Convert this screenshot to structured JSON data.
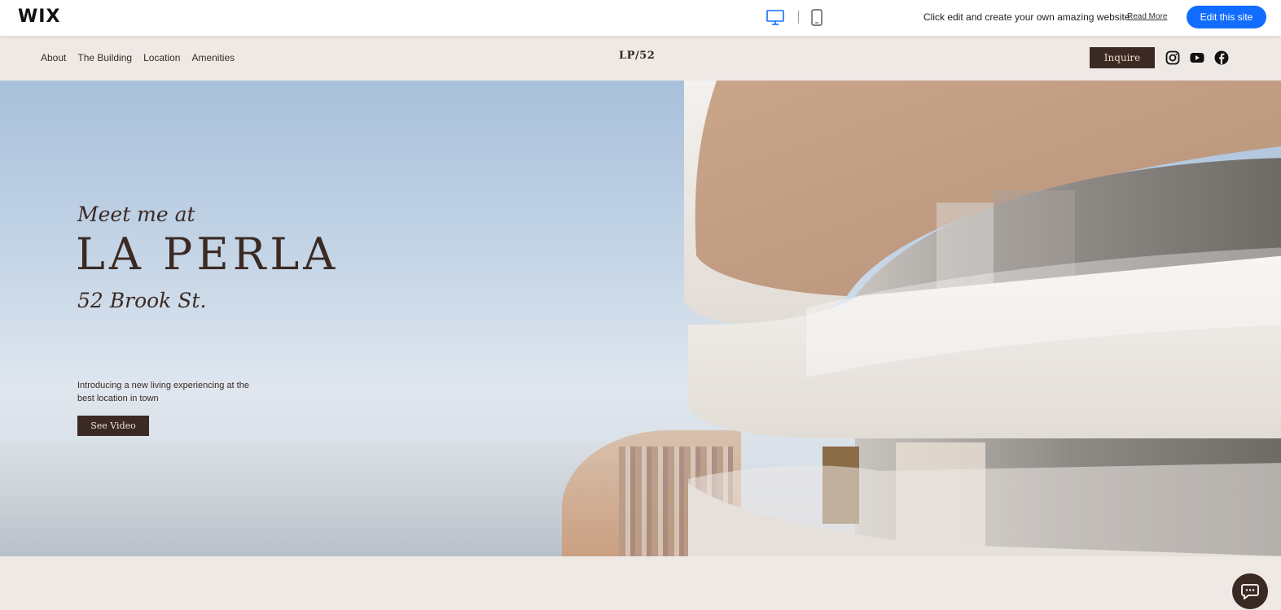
{
  "wix_bar": {
    "logo": "WIX",
    "message": "Click edit and create your own amazing website",
    "read_more": "Read More",
    "edit_button": "Edit this site",
    "icons": [
      "desktop-icon",
      "mobile-icon"
    ]
  },
  "site_header": {
    "nav": [
      "About",
      "The Building",
      "Location",
      "Amenities"
    ],
    "brand": "LP/52",
    "inquire_button": "Inquire",
    "social_icons": [
      "instagram-icon",
      "youtube-icon",
      "facebook-icon"
    ]
  },
  "hero": {
    "pre_title": "Meet me at",
    "title": "LA PERLA",
    "address": "52 Brook St.",
    "description": "Introducing a new living experiencing at the best location in town",
    "cta": "See Video"
  },
  "colors": {
    "accent_dark": "#3b2a23",
    "wix_blue": "#116dff",
    "page_bg": "#efe9e6"
  },
  "chat_icon": "chat-icon"
}
